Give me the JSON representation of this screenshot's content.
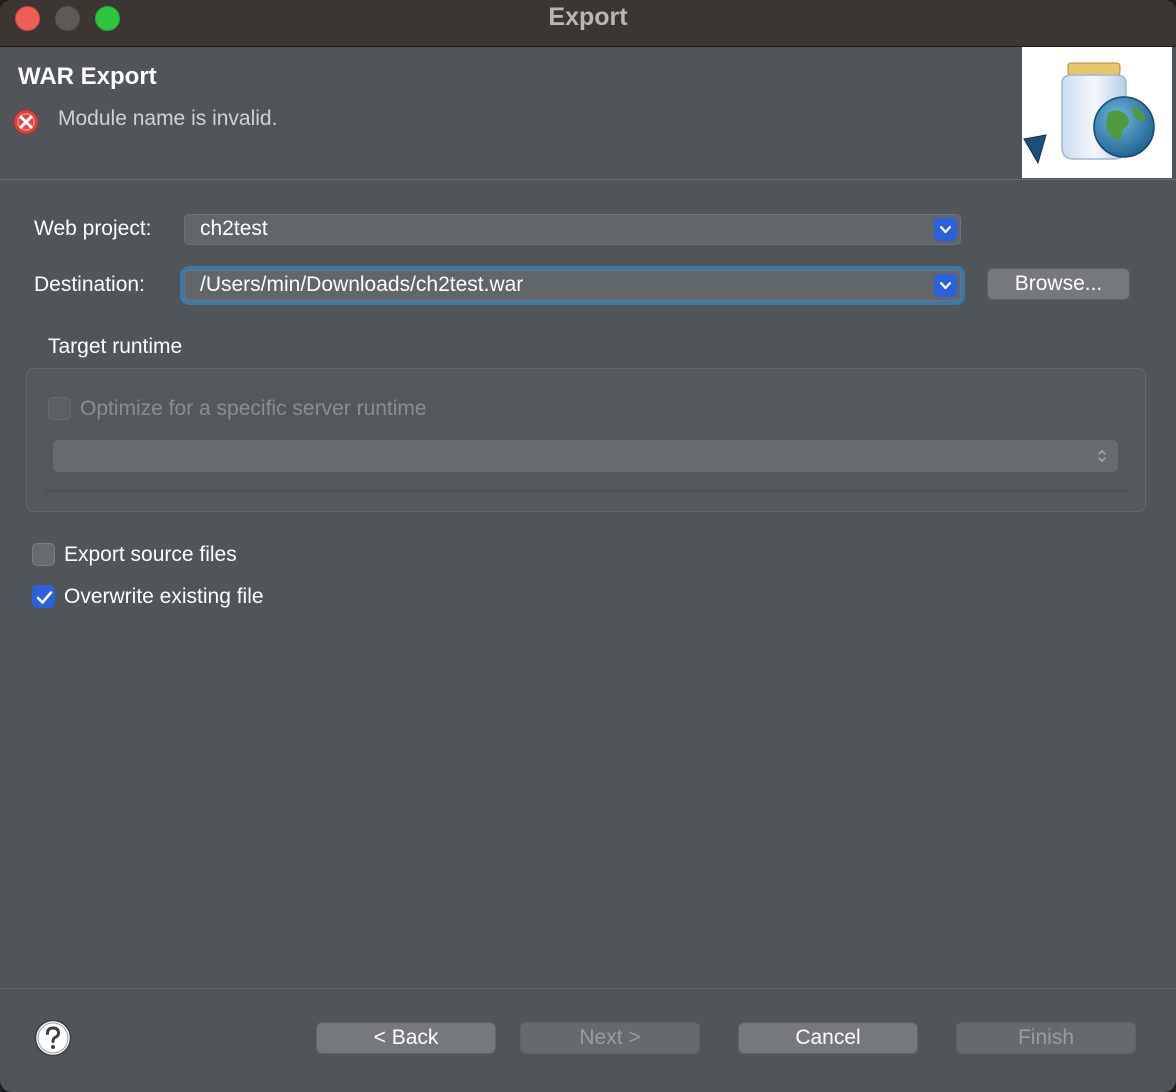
{
  "window": {
    "title": "Export"
  },
  "header": {
    "title": "WAR Export",
    "message": "Module name is invalid."
  },
  "form": {
    "web_project_label": "Web project:",
    "web_project_value": "ch2test",
    "destination_label": "Destination:",
    "destination_value": "/Users/min/Downloads/ch2test.war",
    "browse_label": "Browse..."
  },
  "target_runtime": {
    "title": "Target runtime",
    "optimize_label": "Optimize for a specific server runtime",
    "optimize_checked": false,
    "optimize_enabled": false,
    "runtime_value": ""
  },
  "options": {
    "export_source_label": "Export source files",
    "export_source_checked": false,
    "overwrite_label": "Overwrite existing file",
    "overwrite_checked": true
  },
  "footer": {
    "back_label": "< Back",
    "next_label": "Next >",
    "cancel_label": "Cancel",
    "finish_label": "Finish"
  },
  "colors": {
    "accent": "#2962dc",
    "error": "#e0443e",
    "background": "#50555a"
  }
}
